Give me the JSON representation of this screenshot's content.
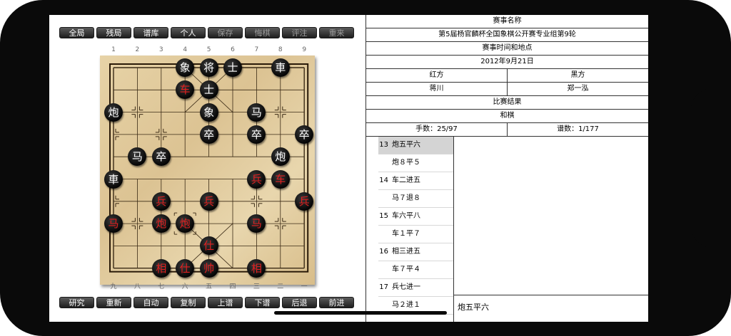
{
  "top_toolbar": [
    {
      "label": "全局",
      "enabled": true
    },
    {
      "label": "残局",
      "enabled": true
    },
    {
      "label": "谱库",
      "enabled": true
    },
    {
      "label": "个人",
      "enabled": true
    },
    {
      "label": "保存",
      "enabled": false
    },
    {
      "label": "悔棋",
      "enabled": false
    },
    {
      "label": "评注",
      "enabled": false
    },
    {
      "label": "重来",
      "enabled": false
    }
  ],
  "bottom_toolbar": [
    {
      "label": "研究",
      "enabled": true
    },
    {
      "label": "重新",
      "enabled": true
    },
    {
      "label": "自动",
      "enabled": true
    },
    {
      "label": "复制",
      "enabled": true
    },
    {
      "label": "上谱",
      "enabled": true
    },
    {
      "label": "下谱",
      "enabled": true
    },
    {
      "label": "后退",
      "enabled": true
    },
    {
      "label": "前进",
      "enabled": true
    }
  ],
  "top_file_numbers": [
    "1",
    "2",
    "3",
    "4",
    "5",
    "6",
    "7",
    "8",
    "9"
  ],
  "bottom_file_numbers": [
    "九",
    "八",
    "七",
    "六",
    "五",
    "四",
    "三",
    "二",
    "一"
  ],
  "pieces": [
    {
      "char": "象",
      "color": "black",
      "file": 3,
      "rank": 0
    },
    {
      "char": "将",
      "color": "black",
      "file": 4,
      "rank": 0
    },
    {
      "char": "士",
      "color": "black",
      "file": 5,
      "rank": 0
    },
    {
      "char": "車",
      "color": "black",
      "file": 7,
      "rank": 0
    },
    {
      "char": "车",
      "color": "red",
      "file": 3,
      "rank": 1
    },
    {
      "char": "士",
      "color": "black",
      "file": 4,
      "rank": 1
    },
    {
      "char": "炮",
      "color": "black",
      "file": 0,
      "rank": 2
    },
    {
      "char": "象",
      "color": "black",
      "file": 4,
      "rank": 2
    },
    {
      "char": "马",
      "color": "black",
      "file": 6,
      "rank": 2
    },
    {
      "char": "卒",
      "color": "black",
      "file": 4,
      "rank": 3
    },
    {
      "char": "卒",
      "color": "black",
      "file": 6,
      "rank": 3
    },
    {
      "char": "卒",
      "color": "black",
      "file": 8,
      "rank": 3
    },
    {
      "char": "马",
      "color": "black",
      "file": 1,
      "rank": 4
    },
    {
      "char": "卒",
      "color": "black",
      "file": 2,
      "rank": 4
    },
    {
      "char": "炮",
      "color": "black",
      "file": 7,
      "rank": 4
    },
    {
      "char": "車",
      "color": "black",
      "file": 0,
      "rank": 5
    },
    {
      "char": "兵",
      "color": "red",
      "file": 6,
      "rank": 5
    },
    {
      "char": "车",
      "color": "red",
      "file": 7,
      "rank": 5
    },
    {
      "char": "兵",
      "color": "red",
      "file": 2,
      "rank": 6
    },
    {
      "char": "兵",
      "color": "red",
      "file": 4,
      "rank": 6
    },
    {
      "char": "兵",
      "color": "red",
      "file": 8,
      "rank": 6
    },
    {
      "char": "马",
      "color": "red",
      "file": 0,
      "rank": 7
    },
    {
      "char": "炮",
      "color": "red",
      "file": 2,
      "rank": 7
    },
    {
      "char": "炮",
      "color": "red",
      "file": 3,
      "rank": 7
    },
    {
      "char": "马",
      "color": "red",
      "file": 6,
      "rank": 7
    },
    {
      "char": "仕",
      "color": "red",
      "file": 4,
      "rank": 8
    },
    {
      "char": "相",
      "color": "red",
      "file": 2,
      "rank": 9
    },
    {
      "char": "仕",
      "color": "red",
      "file": 3,
      "rank": 9
    },
    {
      "char": "帅",
      "color": "red",
      "file": 4,
      "rank": 9
    },
    {
      "char": "相",
      "color": "red",
      "file": 6,
      "rank": 9
    }
  ],
  "last_move_marker": {
    "file": 3,
    "rank": 7
  },
  "info": {
    "event_label": "赛事名称",
    "event_name": "第5届杨官麟杯全国象棋公开赛专业组第9轮",
    "time_place_label": "赛事时间和地点",
    "date": "2012年9月21日",
    "red_label": "红方",
    "black_label": "黑方",
    "red_player": "蒋川",
    "black_player": "郑一泓",
    "result_label": "比赛结果",
    "result": "和棋",
    "moves_count": "手数：25/97",
    "record_count": "谱数：1/177"
  },
  "moves": [
    {
      "num": "13",
      "text": "炮五平六",
      "selected": true
    },
    {
      "num": "",
      "text": "炮８平５",
      "selected": false
    },
    {
      "num": "14",
      "text": "车二进五",
      "selected": false
    },
    {
      "num": "",
      "text": "马７退８",
      "selected": false
    },
    {
      "num": "15",
      "text": "车六平八",
      "selected": false
    },
    {
      "num": "",
      "text": "车１平７",
      "selected": false
    },
    {
      "num": "16",
      "text": "相三进五",
      "selected": false
    },
    {
      "num": "",
      "text": "车７平４",
      "selected": false
    },
    {
      "num": "17",
      "text": "兵七进一",
      "selected": false
    },
    {
      "num": "",
      "text": "马２进１",
      "selected": false
    }
  ],
  "comment": "炮五平六"
}
